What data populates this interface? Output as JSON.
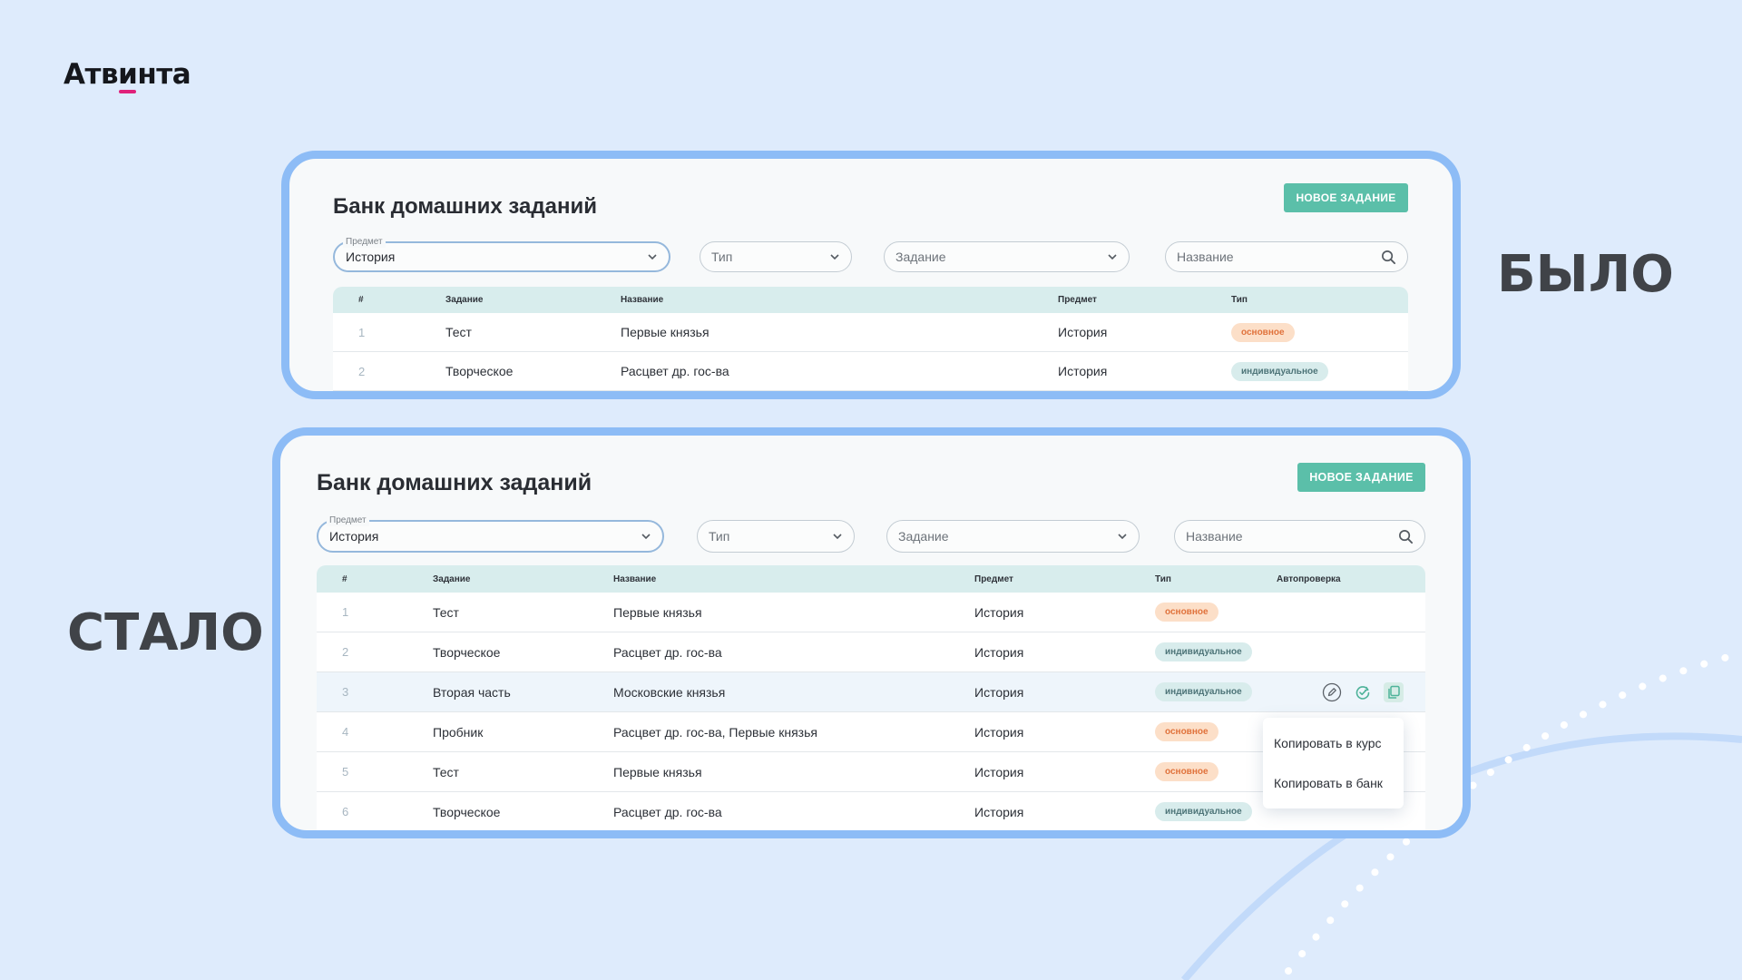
{
  "logo": {
    "pre": "Атв",
    "accent": "и",
    "post": "нта"
  },
  "labels": {
    "before": "БЫЛО",
    "after": "СТАЛО"
  },
  "before": {
    "title": "Банк домашних заданий",
    "new_button": "НОВОЕ ЗАДАНИЕ",
    "filters": {
      "subject_label": "Предмет",
      "subject_value": "История",
      "type_placeholder": "Тип",
      "task_placeholder": "Задание",
      "name_placeholder": "Название"
    },
    "columns": [
      "#",
      "Задание",
      "Название",
      "Предмет",
      "Тип"
    ],
    "rows": [
      {
        "num": "1",
        "task": "Тест",
        "name": "Первые князья",
        "subject": "История",
        "type": "основное",
        "type_kind": "main"
      },
      {
        "num": "2",
        "task": "Творческое",
        "name": "Расцвет др. гос-ва",
        "subject": "История",
        "type": "индивидуальное",
        "type_kind": "ind"
      }
    ]
  },
  "after": {
    "title": "Банк домашних заданий",
    "new_button": "НОВОЕ ЗАДАНИЕ",
    "filters": {
      "subject_label": "Предмет",
      "subject_value": "История",
      "type_placeholder": "Тип",
      "task_placeholder": "Задание",
      "name_placeholder": "Название"
    },
    "columns": [
      "#",
      "Задание",
      "Название",
      "Предмет",
      "Тип",
      "Автопроверка"
    ],
    "rows": [
      {
        "num": "1",
        "task": "Тест",
        "name": "Первые князья",
        "subject": "История",
        "type": "основное",
        "type_kind": "main"
      },
      {
        "num": "2",
        "task": "Творческое",
        "name": "Расцвет др. гос-ва",
        "subject": "История",
        "type": "индивидуальное",
        "type_kind": "ind"
      },
      {
        "num": "3",
        "task": "Вторая часть",
        "name": "Московские князья",
        "subject": "История",
        "type": "индивидуальное",
        "type_kind": "ind"
      },
      {
        "num": "4",
        "task": "Пробник",
        "name": "Расцвет др. гос-ва, Первые князья",
        "subject": "История",
        "type": "основное",
        "type_kind": "main"
      },
      {
        "num": "5",
        "task": "Тест",
        "name": "Первые князья",
        "subject": "История",
        "type": "основное",
        "type_kind": "main"
      },
      {
        "num": "6",
        "task": "Творческое",
        "name": "Расцвет др. гос-ва",
        "subject": "История",
        "type": "индивидуальное",
        "type_kind": "ind"
      }
    ],
    "row_actions": [
      "edit-icon",
      "autocheck-icon",
      "copy-icon"
    ],
    "context_menu": [
      "Копировать в курс",
      "Копировать в банк"
    ]
  },
  "colors": {
    "background": "#deebfc",
    "frame_border": "#8dbcf6",
    "accent_button": "#5bbfa9",
    "table_header": "#d8eded",
    "badge_main_bg": "#fcdfc8",
    "badge_main_text": "#e0723b",
    "badge_ind_bg": "#d8ecec",
    "logo_accent": "#e0217a"
  }
}
